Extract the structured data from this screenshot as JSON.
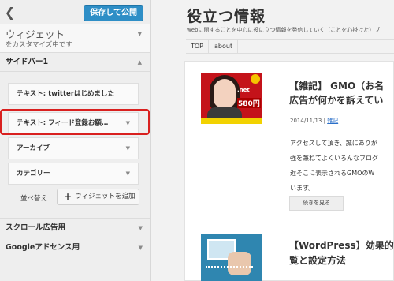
{
  "customizer": {
    "publish_label": "保存して公開",
    "panel_title": "ウィジェット",
    "panel_subtitle": "をカスタマイズ中です",
    "section_title": "サイドバー1",
    "widgets": [
      {
        "label": "テキスト: twitterはじめました"
      },
      {
        "label": "テキスト: フィード登録お願…"
      },
      {
        "label": "アーカイブ"
      },
      {
        "label": "カテゴリー"
      }
    ],
    "reorder_label": "並べ替え",
    "add_widget_label": "ウィジェットを追加",
    "other_sections": [
      {
        "label": "スクロール広告用"
      },
      {
        "label": "Googleアドセンス用"
      }
    ]
  },
  "preview": {
    "site_title": "役立つ情報",
    "site_description": "webに関することを中心に役に立つ情報を発信していく（ことを心掛けた）ブ",
    "nav": [
      "TOP",
      "about"
    ],
    "post1": {
      "title_line1": "【雑記】 GMO（お名",
      "title_line2": "広告が何かを訴えてい",
      "date": "2014/11/13",
      "separator": "|",
      "category": "雑記",
      "excerpt_lines": [
        "アクセスして頂き、誠にありが",
        "強を兼ねてよくいろんなブログ",
        "近そこに表示されるGMOのW",
        "います。"
      ],
      "thumb_text_net": ".net",
      "thumb_text_price": "580円",
      "read_more": "続きを見る"
    },
    "post2": {
      "title_line1": "【WordPress】効果的",
      "title_line2": "覧と設定方法"
    }
  },
  "colors": {
    "publish_button": "#2e8ec6",
    "highlight_border": "#d9201f",
    "link": "#2a6fc9"
  },
  "icons": {
    "back": "chevron-left-icon",
    "collapse": "triangle-down-icon",
    "expand": "triangle-up-icon",
    "add": "plus-icon"
  }
}
